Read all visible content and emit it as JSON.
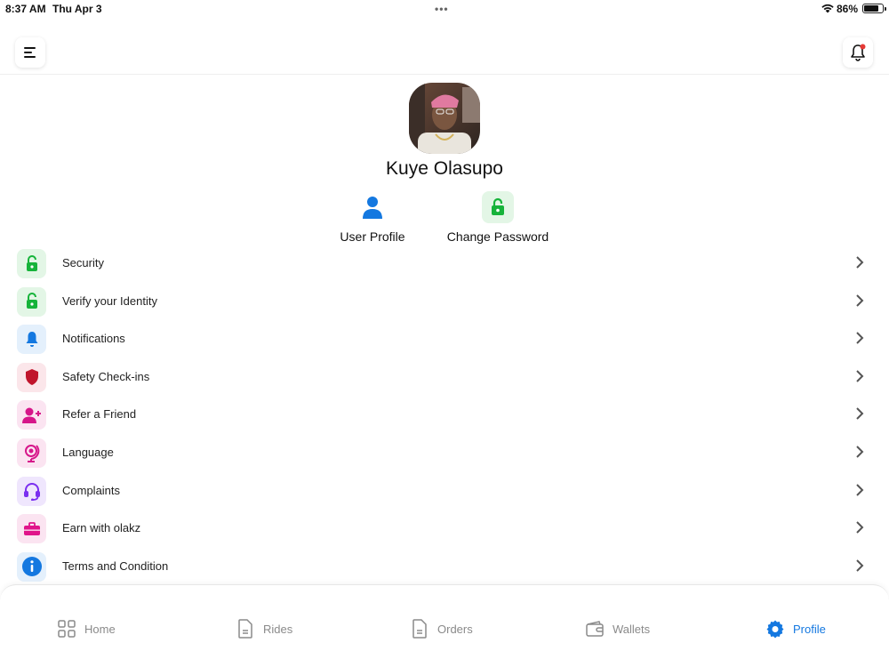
{
  "status_bar": {
    "time": "8:37 AM",
    "date": "Thu Apr 3",
    "battery": "86%"
  },
  "header": {
    "menu_icon": "hamburger-icon",
    "bell_icon": "bell-icon",
    "notification_dot_color": "#e53935"
  },
  "profile": {
    "name": "Kuye Olasupo",
    "actions": [
      {
        "label": "User Profile",
        "icon": "user-icon",
        "color": "#1478e0"
      },
      {
        "label": "Change Password",
        "icon": "lock-icon",
        "color": "#16b33a"
      }
    ]
  },
  "menu": {
    "items": [
      {
        "label": "Security",
        "icon": "lock-open-icon",
        "color": "#16b33a"
      },
      {
        "label": "Verify your Identity",
        "icon": "lock-open-icon",
        "color": "#16b33a"
      },
      {
        "label": "Notifications",
        "icon": "bell-icon",
        "color": "#1478e0"
      },
      {
        "label": "Safety Check-ins",
        "icon": "shield-icon",
        "color": "#c0152c"
      },
      {
        "label": "Refer a Friend",
        "icon": "user-plus-icon",
        "color": "#d6168a"
      },
      {
        "label": "Language",
        "icon": "globe-icon",
        "color": "#d6168a"
      },
      {
        "label": "Complaints",
        "icon": "headset-icon",
        "color": "#7b2ff0"
      },
      {
        "label": "Earn with olakz",
        "icon": "briefcase-icon",
        "color": "#e0148a"
      },
      {
        "label": "Terms and Condition",
        "icon": "info-icon",
        "color": "#1478e0"
      }
    ]
  },
  "bottom_nav": {
    "items": [
      {
        "label": "Home",
        "icon": "grid-icon"
      },
      {
        "label": "Rides",
        "icon": "document-icon"
      },
      {
        "label": "Orders",
        "icon": "document-icon"
      },
      {
        "label": "Wallets",
        "icon": "wallet-icon"
      },
      {
        "label": "Profile",
        "icon": "gear-icon",
        "active": true
      }
    ],
    "active_color": "#1478e0",
    "inactive_color": "#8a8a8a"
  }
}
